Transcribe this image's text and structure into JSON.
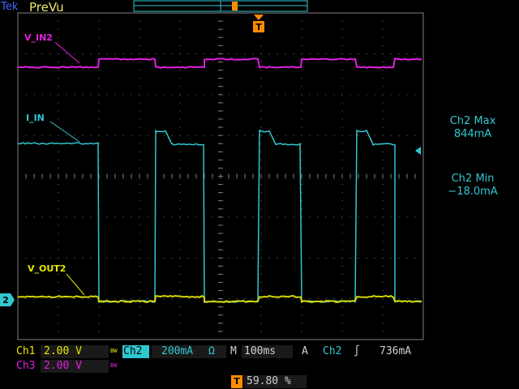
{
  "header": {
    "brand": "Tek",
    "status": "PreVu",
    "trigger_marker": "T"
  },
  "colors": {
    "ch1": "#e6e600",
    "ch2": "#30c8d0",
    "ch3": "#e020e0",
    "grid": "#808080",
    "trigger": "#ff8c00"
  },
  "traces": {
    "v_in2": "V_IN2",
    "i_in": "I_IN",
    "v_out2": "V_OUT2"
  },
  "measurements": {
    "ch2_max_label": "Ch2 Max",
    "ch2_max_value": "844mA",
    "ch2_min_label": "Ch2 Min",
    "ch2_min_value": "−18.0mA"
  },
  "markers": {
    "ch2_level": "2"
  },
  "bottom": {
    "ch1_label": "Ch1",
    "ch1_scale": "2.00 V",
    "ch1_bw": "BW",
    "ch2_label": "Ch2",
    "ch2_scale": "200mA",
    "ch2_unit": "Ω",
    "time_label": "M",
    "time_scale": "100ms",
    "trig_mode": "A",
    "trig_src": "Ch2",
    "trig_slope": "∫",
    "trig_level": "736mA",
    "ch3_label": "Ch3",
    "ch3_scale": "2.00 V",
    "ch3_bw": "BW",
    "trig_pos": "59.80 %"
  }
}
